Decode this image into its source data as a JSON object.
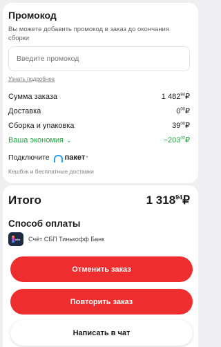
{
  "promo": {
    "title": "Промокод",
    "description": "Вы можете добавить промокод в заказ до окончания сборки",
    "input_placeholder": "Введите промокод",
    "input_value": "",
    "learn_more": "Узнать подробнее"
  },
  "summary": {
    "order_sum": {
      "label": "Сумма заказа",
      "main": "1 482",
      "kop": "94",
      "cur": "₽"
    },
    "delivery": {
      "label": "Доставка",
      "main": "0",
      "kop": "00",
      "cur": "₽"
    },
    "assembly": {
      "label": "Сборка и упаковка",
      "main": "39",
      "kop": "00",
      "cur": "₽"
    },
    "savings": {
      "label": "Ваша экономия",
      "value": "−203",
      "kop": "00",
      "cur": "₽"
    }
  },
  "paket": {
    "label": "Подключите",
    "brand": "пакет",
    "brand_mark": "+",
    "cashback": "Кешбэк и бесплатные доставки"
  },
  "total": {
    "label": "Итого",
    "main": "1 318",
    "kop": "94",
    "cur": "₽"
  },
  "payment": {
    "title": "Способ оплаты",
    "method": "Счёт СБП Тинькофф Банк",
    "icon_text": "сбп"
  },
  "buttons": {
    "cancel": "Отменить заказ",
    "repeat": "Повторить заказ",
    "chat": "Написать в чат"
  },
  "colors": {
    "accent_red": "#ee2e2e",
    "savings_green": "#1e9e3e",
    "paket_blue": "#2a9df4"
  }
}
